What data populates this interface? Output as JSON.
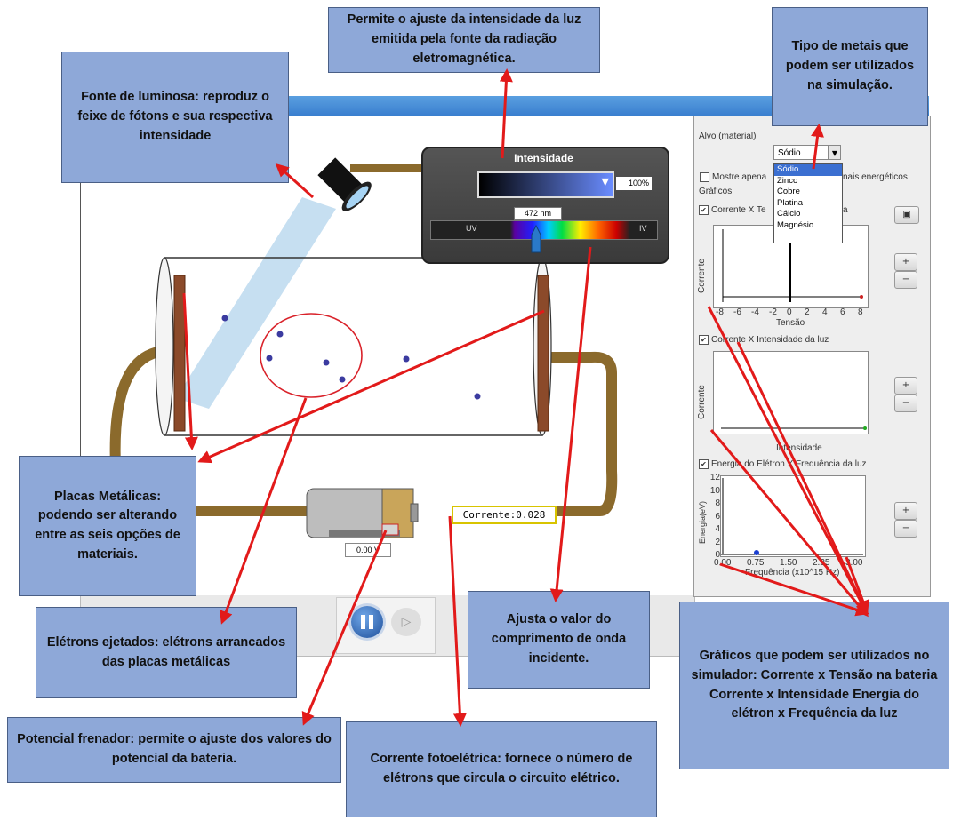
{
  "callouts": {
    "intensity_control": "Permite o ajuste da intensidade da luz emitida pela fonte da radiação eletromagnética.",
    "light_source": "Fonte de luminosa: reproduz o feixe de fótons e sua respectiva intensidade",
    "metal_types": "Tipo de metais que podem ser utilizados na simulação.",
    "metal_plates": "Placas Metálicas: podendo ser alterando entre as seis opções de materiais.",
    "ejected_electrons": "Elétrons ejetados: elétrons arrancados das placas metálicas",
    "wavelength": "Ajusta o valor do comprimento de onda incidente.",
    "graphs": "Gráficos que podem ser utilizados no simulador: Corrente x Tensão na bateria Corrente x Intensidade Energia do elétron x Frequência da luz",
    "stopping_potential": "Potencial frenador: permite o ajuste dos valores do potencial da bateria.",
    "photocurrent": "Corrente fotoelétrica: fornece o número de elétrons que circula o circuito elétrico."
  },
  "simulation": {
    "intensity_title": "Intensidade",
    "intensity_value": "100%",
    "wavelength_value": "472 nm",
    "spectrum_left": "UV",
    "spectrum_right": "IV",
    "current_label": "Corrente:0.028",
    "voltage_value": "0.00 V"
  },
  "panel": {
    "target_label": "Alvo (material)",
    "selected_metal": "Sódio",
    "metals": [
      "Sódio",
      "Zinco",
      "Cobre",
      "Platina",
      "Cálcio",
      "Magnésio"
    ],
    "show_only_prefix": "Mostre apena",
    "show_only_suffix": "nais energéticos",
    "graphs_label": "Gráficos",
    "graph1_label_prefix": "Corrente X Te",
    "graph1_label_suffix": "a",
    "graph1_xlabel": "Tensão",
    "graph1_ylabel": "Corrente",
    "graph1_xticks": [
      "-8",
      "-6",
      "-4",
      "-2",
      "0",
      "2",
      "4",
      "6",
      "8"
    ],
    "graph2_label": "Corrente X Intensidade da luz",
    "graph2_xlabel": "Intensidade",
    "graph2_ylabel": "Corrente",
    "graph3_label": "Energia do Elétron X Frequência da luz",
    "graph3_xlabel": "Frequência (x10^15 Hz)",
    "graph3_ylabel": "Energia(eV)",
    "graph3_yticks": [
      "12",
      "10",
      "8",
      "6",
      "4",
      "2",
      "0"
    ],
    "graph3_xticks": [
      "0.00",
      "0.75",
      "1.50",
      "2.25",
      "3.00"
    ],
    "zoom_in": "+",
    "zoom_out": "−"
  }
}
